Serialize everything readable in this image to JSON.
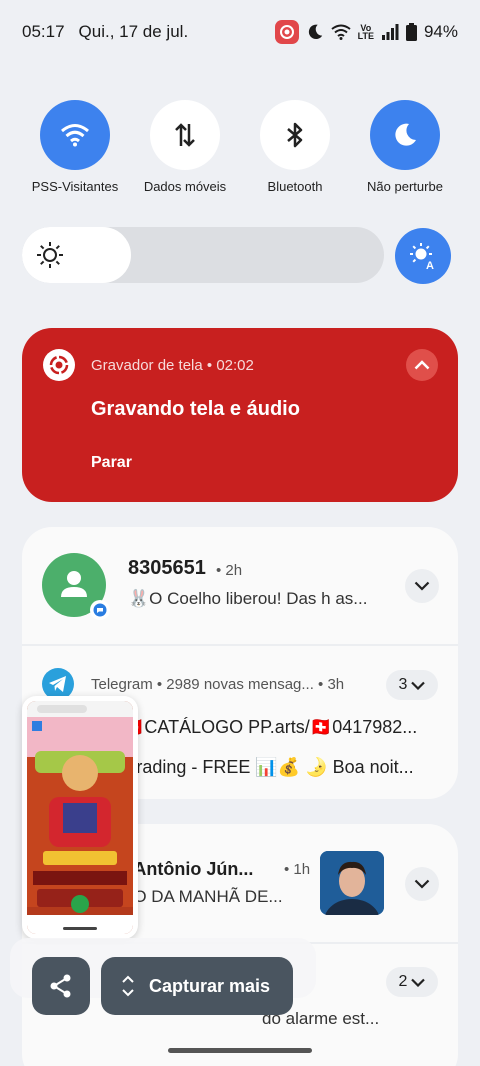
{
  "status_bar": {
    "time": "05:17",
    "date": "Qui., 17 de jul.",
    "volte_top": "Vo",
    "volte_bottom": "LTE",
    "battery": "94%"
  },
  "quick_settings": [
    {
      "label": "PSS-Visitantes",
      "icon": "wifi-icon",
      "active": true
    },
    {
      "label": "Dados móveis",
      "icon": "mobile-data-icon",
      "active": false
    },
    {
      "label": "Bluetooth",
      "icon": "bluetooth-icon",
      "active": false
    },
    {
      "label": "Não perturbe",
      "icon": "moon-icon",
      "active": true
    }
  ],
  "brightness": {
    "level": 0.3
  },
  "recorder": {
    "header": "Gravador de tela • 02:02",
    "title": "Gravando tela e áudio",
    "action": "Parar",
    "color": "#c8201f"
  },
  "notification_1": {
    "title": "8305651",
    "time": "• 2h",
    "text": "🐰O Coelho liberou! Das h as..."
  },
  "telegram": {
    "header": "Telegram • 2989 novas mensag... • 3h",
    "count": "3",
    "line1": "🇨🇭CATÁLOGO PP.arts/🇨🇭0417982...",
    "line2": "iTrading - FREE 📊💰 🌛 Boa noit..."
  },
  "notification_2": {
    "title": "r Antônio Jún...",
    "time": "• 1h",
    "text": "ÃO DA MANHÃ DE..."
  },
  "notification_3": {
    "count": "2",
    "text": "do alarme est..."
  },
  "capture_toolbar": {
    "capture_more": "Capturar mais"
  }
}
